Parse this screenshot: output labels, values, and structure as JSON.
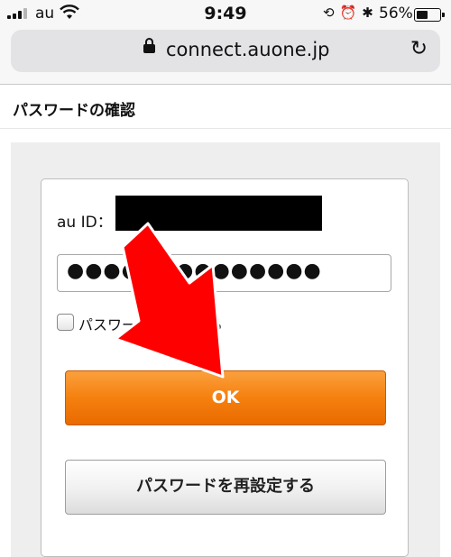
{
  "status_bar": {
    "carrier": "au",
    "time": "9:49",
    "battery": "56%",
    "battery_level": 0.56
  },
  "browser": {
    "url": "connect.auone.jp",
    "reload_glyph": "↻"
  },
  "page": {
    "title": "パスワードの確認"
  },
  "form": {
    "au_id_label": "au ID：",
    "password_value": "●●●●●●●●●●●●●●",
    "checkbox_label": "パスワードを表示する",
    "ok_label": "OK",
    "reset_label": "パスワードを再設定する"
  },
  "colors": {
    "ok_button": "#f5800f",
    "annotation_arrow": "#ff0000"
  }
}
